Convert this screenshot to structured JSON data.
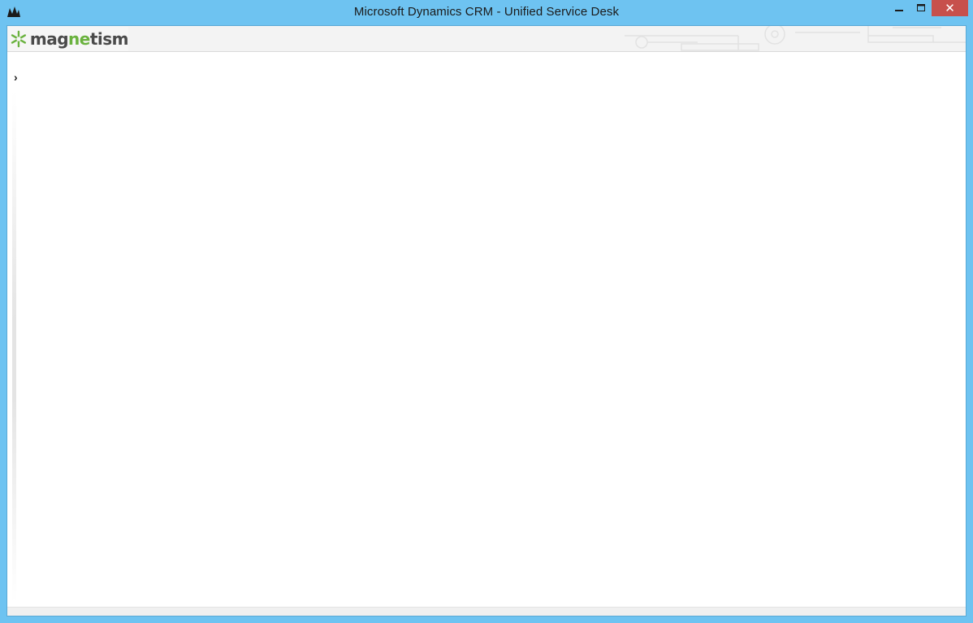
{
  "window": {
    "title": "Microsoft Dynamics CRM - Unified Service Desk",
    "icon": "dynamics-crm-icon",
    "controls": {
      "minimize_icon": "minimize-icon",
      "maximize_icon": "maximize-icon",
      "close_label": "✕"
    }
  },
  "header": {
    "logo": {
      "part1": "mag",
      "part2": "ne",
      "part3": "tism",
      "accent_color": "#6ab23e",
      "text_color": "#4a4a4a"
    }
  },
  "main": {
    "expander_glyph": "›"
  },
  "colors": {
    "frame": "#6ec3f1",
    "close_button": "#c7504c"
  }
}
